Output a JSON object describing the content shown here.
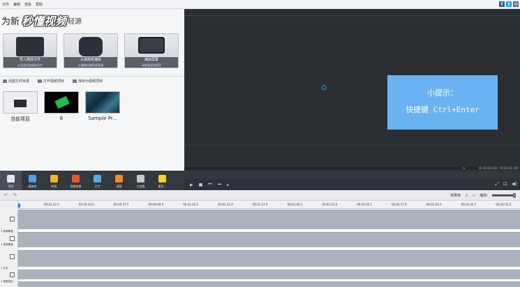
{
  "menu": {
    "items": [
      "文件",
      "编辑",
      "查看",
      "帮助"
    ]
  },
  "social": [
    "f",
    "t",
    "✉"
  ],
  "watermark": {
    "prefix": "为新",
    "logo": "秒懂视频",
    "suffix": "轻源"
  },
  "big_buttons": [
    {
      "title": "导入媒体文件",
      "subtitle": "从这里添加媒体文件"
    },
    {
      "title": "从摄像机捕获",
      "subtitle": "从摄像机捕获视频源"
    },
    {
      "title": "捕获屏幕",
      "subtitle": "录制桌面和程序"
    }
  ],
  "project_bar": [
    "创建文件目录",
    "打开视频项目",
    "保存为视频项目"
  ],
  "thumbnails": [
    "当前项目",
    "6",
    "Sample Pr..."
  ],
  "tip": {
    "title": "小提示：",
    "text": "快捷键 Ctrl+Enter"
  },
  "preview": {
    "zoom": "1x",
    "time": "00:00:00.000 / 00:00:00.000"
  },
  "playback": {
    "buttons": [
      "▶",
      "■",
      "⏮",
      "⏭",
      "▸"
    ],
    "right": [
      "⤢",
      "⊡",
      "◀)"
    ]
  },
  "toolbar": [
    {
      "label": "项目",
      "color": "#e6e6e6"
    },
    {
      "label": "媒体库",
      "color": "#4da0e6"
    },
    {
      "label": "转场",
      "color": "#f0b429"
    },
    {
      "label": "视频效果",
      "color": "#e85a2c"
    },
    {
      "label": "文字",
      "color": "#5aa9e6"
    },
    {
      "label": "滤镜",
      "color": "#f08a24"
    },
    {
      "label": "九宫格",
      "color": "#c9c9c9"
    },
    {
      "label": "更多...",
      "color": "#f5d12b"
    }
  ],
  "timeline_header": {
    "undo": "↶",
    "redo": "↷",
    "effects": "效果库",
    "zoom_label": "缩放:"
  },
  "ruler_ticks": [
    "00:01:12.5",
    "00:00:25.0",
    "00:00:37.5",
    "00:00:50.0",
    "00:01:02.5",
    "00:01:15.0",
    "00:01:27.6",
    "00:01:40.1",
    "00:01:52.6",
    "00:02:05.1",
    "00:02:17.6",
    "00:02:30.1",
    "00:02:42.7",
    "00:02:55.2"
  ],
  "track_labels": [
    "1 视频覆盖",
    "1 视频覆盖",
    "1 文字",
    "1 视频混合"
  ]
}
